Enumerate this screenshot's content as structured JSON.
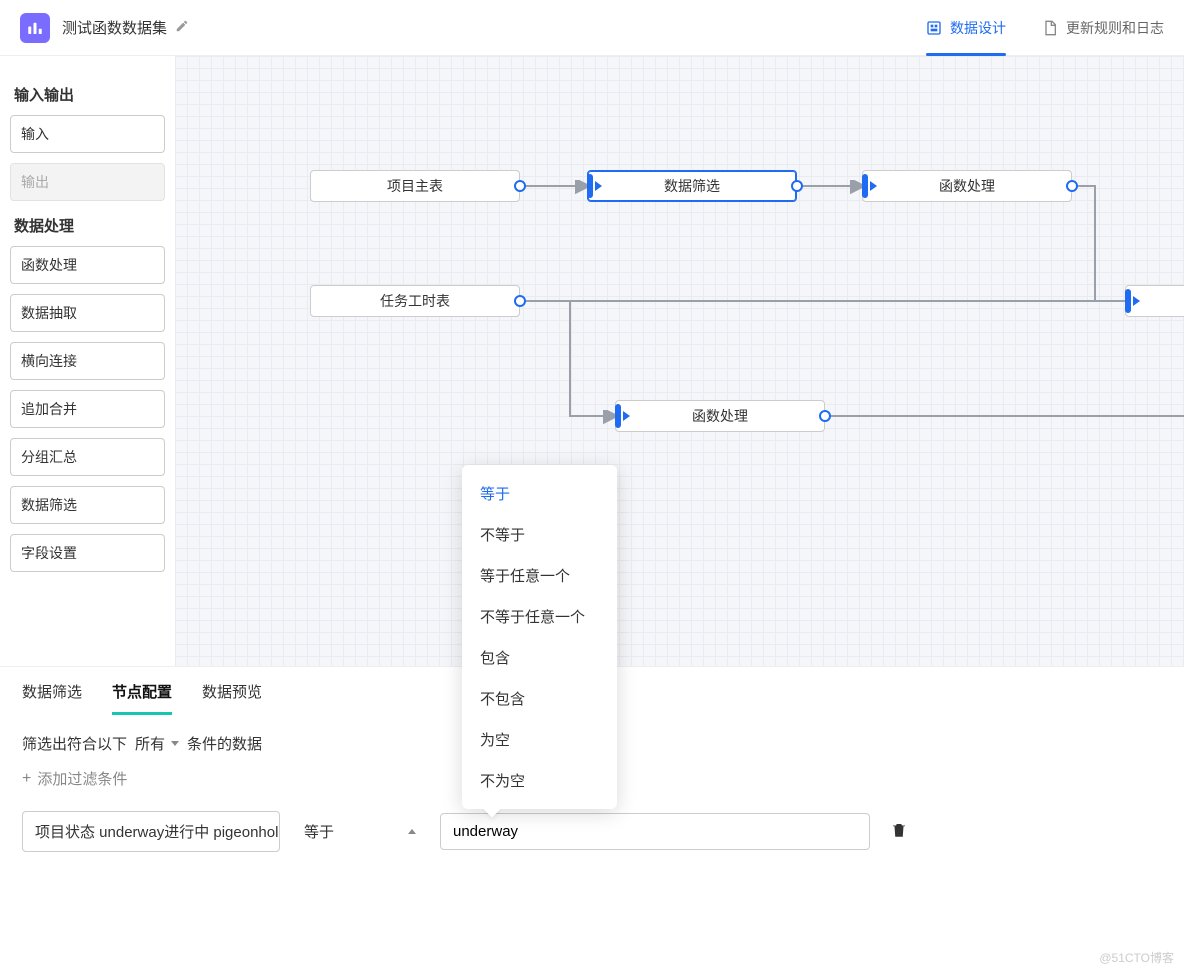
{
  "header": {
    "title": "测试函数数据集",
    "tabs": [
      {
        "label": "数据设计",
        "active": true
      },
      {
        "label": "更新规则和日志",
        "active": false
      }
    ]
  },
  "sidebar": {
    "section1_title": "输入输出",
    "section1_items": [
      {
        "label": "输入",
        "disabled": false
      },
      {
        "label": "输出",
        "disabled": true
      }
    ],
    "section2_title": "数据处理",
    "section2_items": [
      {
        "label": "函数处理"
      },
      {
        "label": "数据抽取"
      },
      {
        "label": "横向连接"
      },
      {
        "label": "追加合并"
      },
      {
        "label": "分组汇总"
      },
      {
        "label": "数据筛选"
      },
      {
        "label": "字段设置"
      }
    ]
  },
  "canvas": {
    "nodes": {
      "n1": {
        "label": "项目主表"
      },
      "n2": {
        "label": "数据筛选"
      },
      "n3": {
        "label": "函数处理"
      },
      "n4": {
        "label": "任务工时表"
      },
      "n5": {
        "label": "函数处理"
      }
    }
  },
  "panel": {
    "tabs": [
      {
        "label": "数据筛选"
      },
      {
        "label": "节点配置"
      },
      {
        "label": "数据预览"
      }
    ],
    "active_tab_index": 1,
    "text_prefix": "筛选出符合以下",
    "scope_value": "所有",
    "text_suffix": "条件的数据",
    "add_filter_label": "添加过滤条件",
    "filter": {
      "field_label": "项目状态 underway进行中 pigeonhol",
      "operator_label": "等于",
      "value": "underway"
    }
  },
  "dropdown": {
    "items": [
      "等于",
      "不等于",
      "等于任意一个",
      "不等于任意一个",
      "包含",
      "不包含",
      "为空",
      "不为空"
    ],
    "selected_index": 0
  },
  "watermark": "@51CTO博客"
}
